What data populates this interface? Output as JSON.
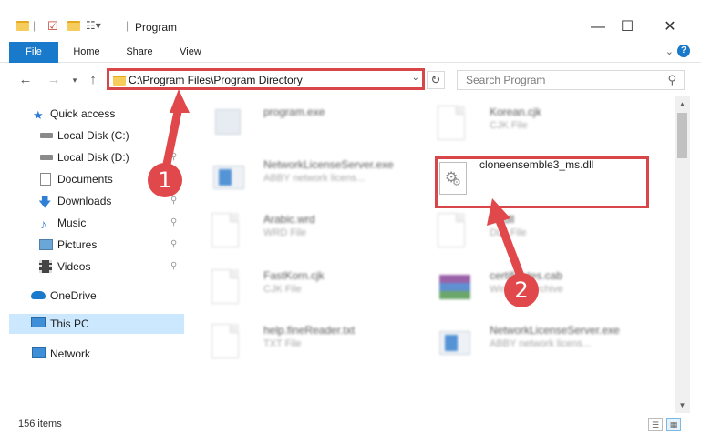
{
  "window": {
    "title": "Program",
    "minimize_icon": "—",
    "maximize_icon": "☐",
    "close_icon": "✕"
  },
  "ribbon": {
    "tabs": [
      "File",
      "Home",
      "Share",
      "View"
    ],
    "help": "?"
  },
  "address": {
    "path": "C:\\Program Files\\Program Directory",
    "search_placeholder": "Search Program"
  },
  "sidebar": {
    "items": [
      {
        "label": "Quick access",
        "icon": "star-icon",
        "pinned": false
      },
      {
        "label": "Local Disk (C:)",
        "icon": "disk-icon",
        "pinned": true
      },
      {
        "label": "Local Disk (D:)",
        "icon": "disk-icon",
        "pinned": true
      },
      {
        "label": "Documents",
        "icon": "documents-icon",
        "pinned": true
      },
      {
        "label": "Downloads",
        "icon": "downloads-icon",
        "pinned": true
      },
      {
        "label": "Music",
        "icon": "music-icon",
        "pinned": true
      },
      {
        "label": "Pictures",
        "icon": "pictures-icon",
        "pinned": true
      },
      {
        "label": "Videos",
        "icon": "videos-icon",
        "pinned": true
      },
      {
        "label": "OneDrive",
        "icon": "onedrive-icon",
        "pinned": false
      },
      {
        "label": "This PC",
        "icon": "pc-icon",
        "pinned": false,
        "selected": true
      },
      {
        "label": "Network",
        "icon": "network-icon",
        "pinned": false
      }
    ]
  },
  "files": [
    {
      "name": "program.exe",
      "type": "",
      "icon": "exe-icon",
      "blurred": true
    },
    {
      "name": "Korean.cjk",
      "type": "CJK File",
      "icon": "document-icon",
      "blurred": true
    },
    {
      "name": "NetworkLicenseServer.exe",
      "type": "ABBY network licens...",
      "icon": "exe-icon",
      "blurred": true
    },
    {
      "name": "cloneensemble3_ms.dll",
      "type": "",
      "icon": "dll-icon",
      "blurred": false
    },
    {
      "name": "Arabic.wrd",
      "type": "WRD File",
      "icon": "document-icon",
      "blurred": true
    },
    {
      "name": "clr.dll",
      "type": "DLL File",
      "icon": "document-icon",
      "blurred": true
    },
    {
      "name": "FastKorn.cjk",
      "type": "CJK File",
      "icon": "document-icon",
      "blurred": true
    },
    {
      "name": "certificates.cab",
      "type": "WinRAR archive",
      "icon": "archive-icon",
      "blurred": true
    },
    {
      "name": "help.fineReader.txt",
      "type": "TXT File",
      "icon": "document-icon",
      "blurred": true
    },
    {
      "name": "NetworkLicenseServer.exe",
      "type": "ABBY network licens...",
      "icon": "exe-icon",
      "blurred": true
    }
  ],
  "status": {
    "count": "156 items"
  },
  "annotations": {
    "step1": "1",
    "step2": "2",
    "color": "#e0484b"
  }
}
